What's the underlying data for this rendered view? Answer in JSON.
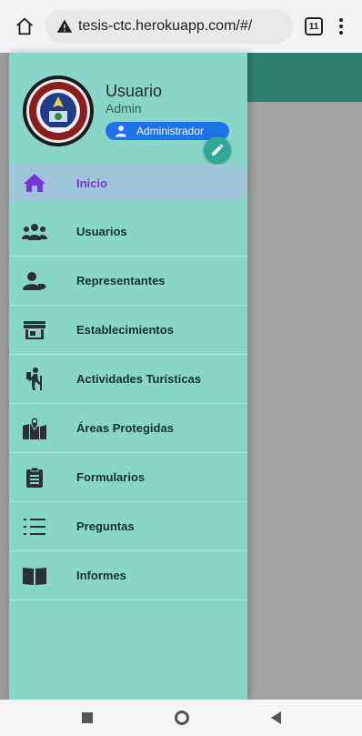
{
  "browser": {
    "url": "tesis-ctc.herokuapp.com/#/",
    "tab_count": "11"
  },
  "profile": {
    "name": "Usuario",
    "role": "Admin",
    "badge": "Administrador"
  },
  "nav": [
    {
      "label": "Inicio",
      "icon": "home-icon",
      "active": true
    },
    {
      "label": "Usuarios",
      "icon": "users-icon"
    },
    {
      "label": "Representantes",
      "icon": "representative-icon"
    },
    {
      "label": "Establecimientos",
      "icon": "store-icon"
    },
    {
      "label": "Actividades Turísticas",
      "icon": "hiking-icon"
    },
    {
      "label": "Áreas Protegidas",
      "icon": "map-pin-icon"
    },
    {
      "label": "Formularios",
      "icon": "clipboard-icon"
    },
    {
      "label": "Preguntas",
      "icon": "list-icon"
    },
    {
      "label": "Informes",
      "icon": "book-icon"
    }
  ],
  "colors": {
    "drawer": "#87d6c8",
    "active_text": "#7a35d8",
    "badge": "#1f73e8",
    "topbar": "#2f7f70"
  }
}
